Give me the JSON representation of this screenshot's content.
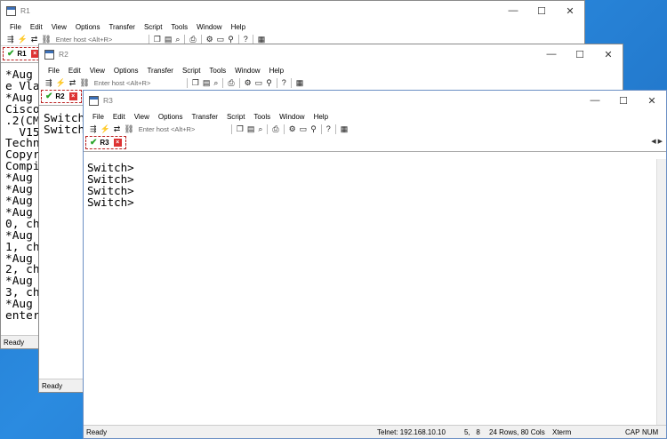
{
  "menu": [
    "File",
    "Edit",
    "View",
    "Options",
    "Transfer",
    "Script",
    "Tools",
    "Window",
    "Help"
  ],
  "host_placeholder": "Enter host <Alt+R>",
  "window_controls": {
    "minimize": "—",
    "maximize": "☐",
    "close": "✕"
  },
  "toolbar_icons": [
    "connect-icon",
    "lightning-icon",
    "reconnect-icon",
    "link-icon",
    "copy-icon",
    "paste-icon",
    "find-icon",
    "print-icon",
    "settings-icon",
    "keymap-icon",
    "sftp-icon",
    "help-icon",
    "session-icon"
  ],
  "r1": {
    "title": "R1",
    "tab": "R1",
    "lines": [
      "*Aug",
      "e Vla",
      "*Aug",
      "Cisco",
      ".2(CM",
      "  V15",
      "Techn",
      "Copyr",
      "Compi",
      "*Aug",
      "*Aug",
      "*Aug",
      "*Aug",
      "0, ch",
      "*Aug",
      "1, ch",
      "*Aug",
      "2, ch",
      "*Aug",
      "3, ch",
      "*Aug",
      "enter"
    ],
    "status": "Ready"
  },
  "r2": {
    "title": "R2",
    "tab": "R2",
    "lines": [
      "Switch",
      "Switch"
    ],
    "status": "Ready"
  },
  "r3": {
    "title": "R3",
    "tab": "R3",
    "lines": [
      "Switch>",
      "Switch>",
      "Switch>",
      "Switch>"
    ],
    "status": {
      "ready": "Ready",
      "telnet": "Telnet: 192.168.10.10",
      "cursor": "5,   8",
      "size": "24 Rows, 80 Cols",
      "term": "Xterm",
      "cap": "CAP",
      "num": "NUM"
    }
  }
}
